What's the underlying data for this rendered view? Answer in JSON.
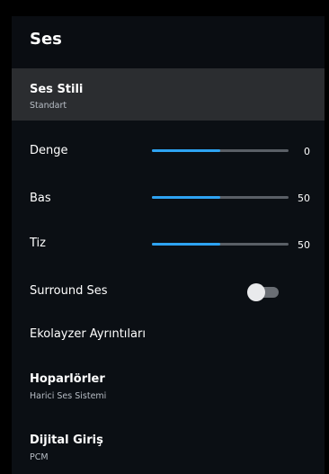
{
  "header": {
    "title": "Ses"
  },
  "items": {
    "sound_style": {
      "label": "Ses Stili",
      "value": "Standart"
    },
    "balance": {
      "label": "Denge",
      "value": "0",
      "fill": 0.5
    },
    "bass": {
      "label": "Bas",
      "value": "50",
      "fill": 0.5
    },
    "treble": {
      "label": "Tiz",
      "value": "50",
      "fill": 0.5
    },
    "surround": {
      "label": "Surround Ses",
      "on": false
    },
    "equalizer": {
      "label": "Ekolayzer Ayrıntıları"
    },
    "speakers": {
      "label": "Hoparlörler",
      "value": "Harici Ses Sistemi"
    },
    "digital_input": {
      "label": "Dijital Giriş",
      "value": "PCM"
    }
  },
  "colors": {
    "accent": "#2ea3f2",
    "track": "#5a5f66",
    "selected_row": "#2b2d30",
    "panel": "#0b0f14"
  }
}
